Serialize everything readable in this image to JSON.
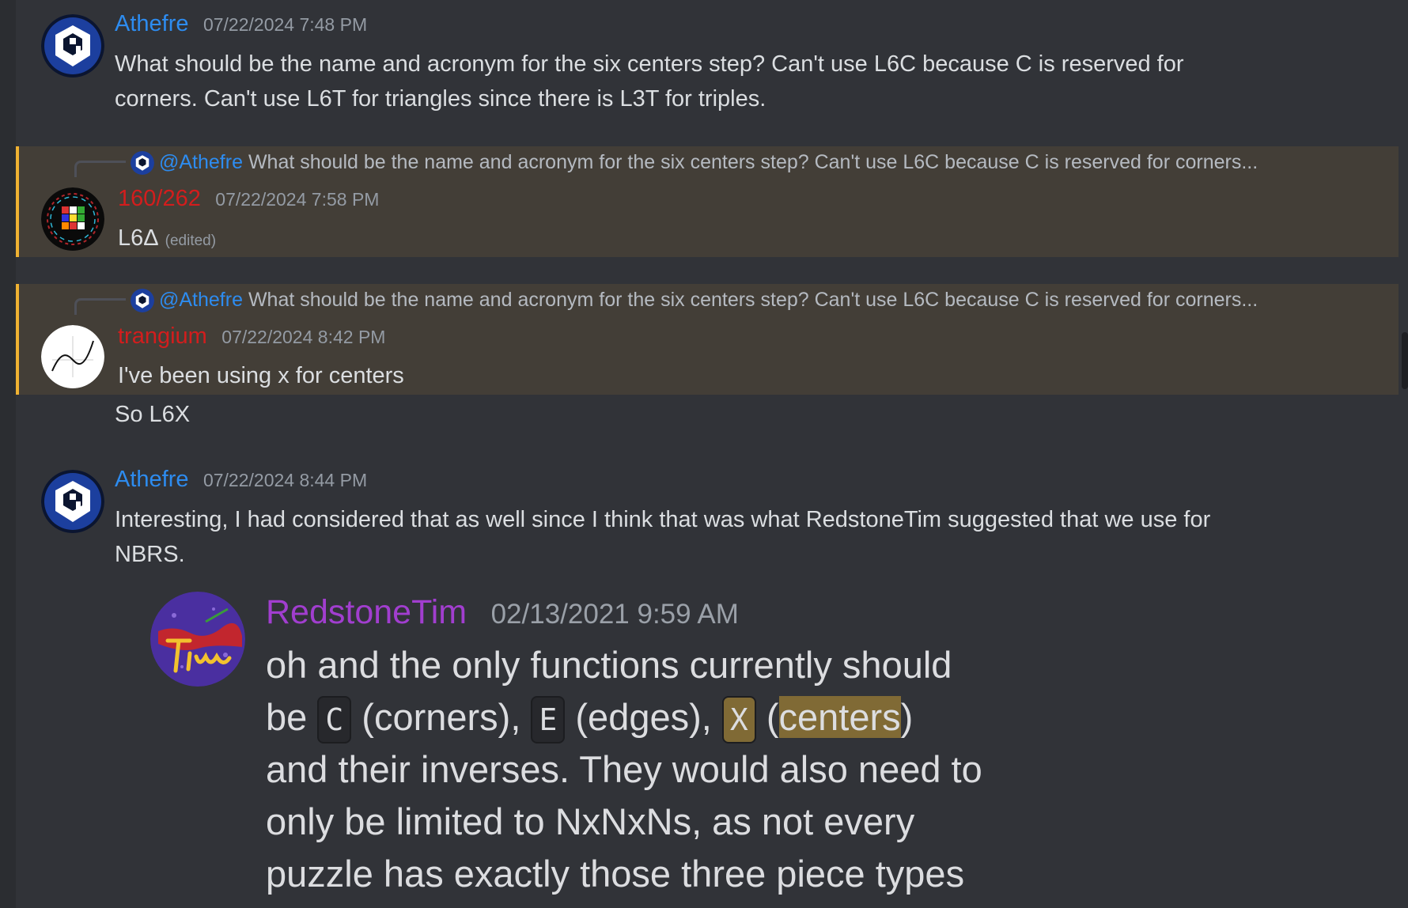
{
  "colors": {
    "background": "#313338",
    "mention_highlight_bg": "#433e37",
    "mention_border": "#f0b232",
    "athefre_name": "#2d8cf0",
    "red_user_name": "#d31d1d",
    "redstone_name": "#a13ecf"
  },
  "messages": [
    {
      "author": "Athefre",
      "timestamp": "07/22/2024 7:48 PM",
      "avatar_icon": "cube-logo-icon",
      "line1": "What should be the name and acronym for the six centers step? Can't use L6C because C is reserved for",
      "line2": "corners. Can't use L6T for triangles since there is L3T for triples."
    },
    {
      "reply_to": "@Athefre",
      "reply_preview": "What should be the name and acronym for the six centers step? Can't use L6C because C is reserved for corners...",
      "author": "160/262",
      "timestamp": "07/22/2024 7:58 PM",
      "avatar_icon": "rubiks-cube-icon",
      "text": "L6Δ",
      "edited": "(edited)"
    },
    {
      "reply_to": "@Athefre",
      "reply_preview": "What should be the name and acronym for the six centers step? Can't use L6C because C is reserved for corners...",
      "author": "trangium",
      "timestamp": "07/22/2024 8:42 PM",
      "avatar_icon": "curve-graph-icon",
      "text": "I've been using x for centers",
      "followup": "So L6X"
    },
    {
      "author": "Athefre",
      "timestamp": "07/22/2024 8:44 PM",
      "avatar_icon": "cube-logo-icon",
      "line1": "Interesting, I had considered that as well since I think that was what RedstoneTim suggested that we use for",
      "line2": "NBRS."
    }
  ],
  "embed": {
    "author": "RedstoneTim",
    "timestamp": "02/13/2021 9:59 AM",
    "avatar_icon": "tim-signature-icon",
    "line1": "oh and the only functions currently should",
    "line2_a": "be",
    "code1": "C",
    "line2_b": "(corners),",
    "code2": "E",
    "line2_c": "(edges),",
    "code3": "X",
    "line2_d": "(",
    "line2_highlight": "centers",
    "line2_e": ")",
    "line3": "and their inverses. They would also need to",
    "line4": "only be limited to NxNxNs, as not every",
    "line5": "puzzle has exactly those three piece types"
  }
}
